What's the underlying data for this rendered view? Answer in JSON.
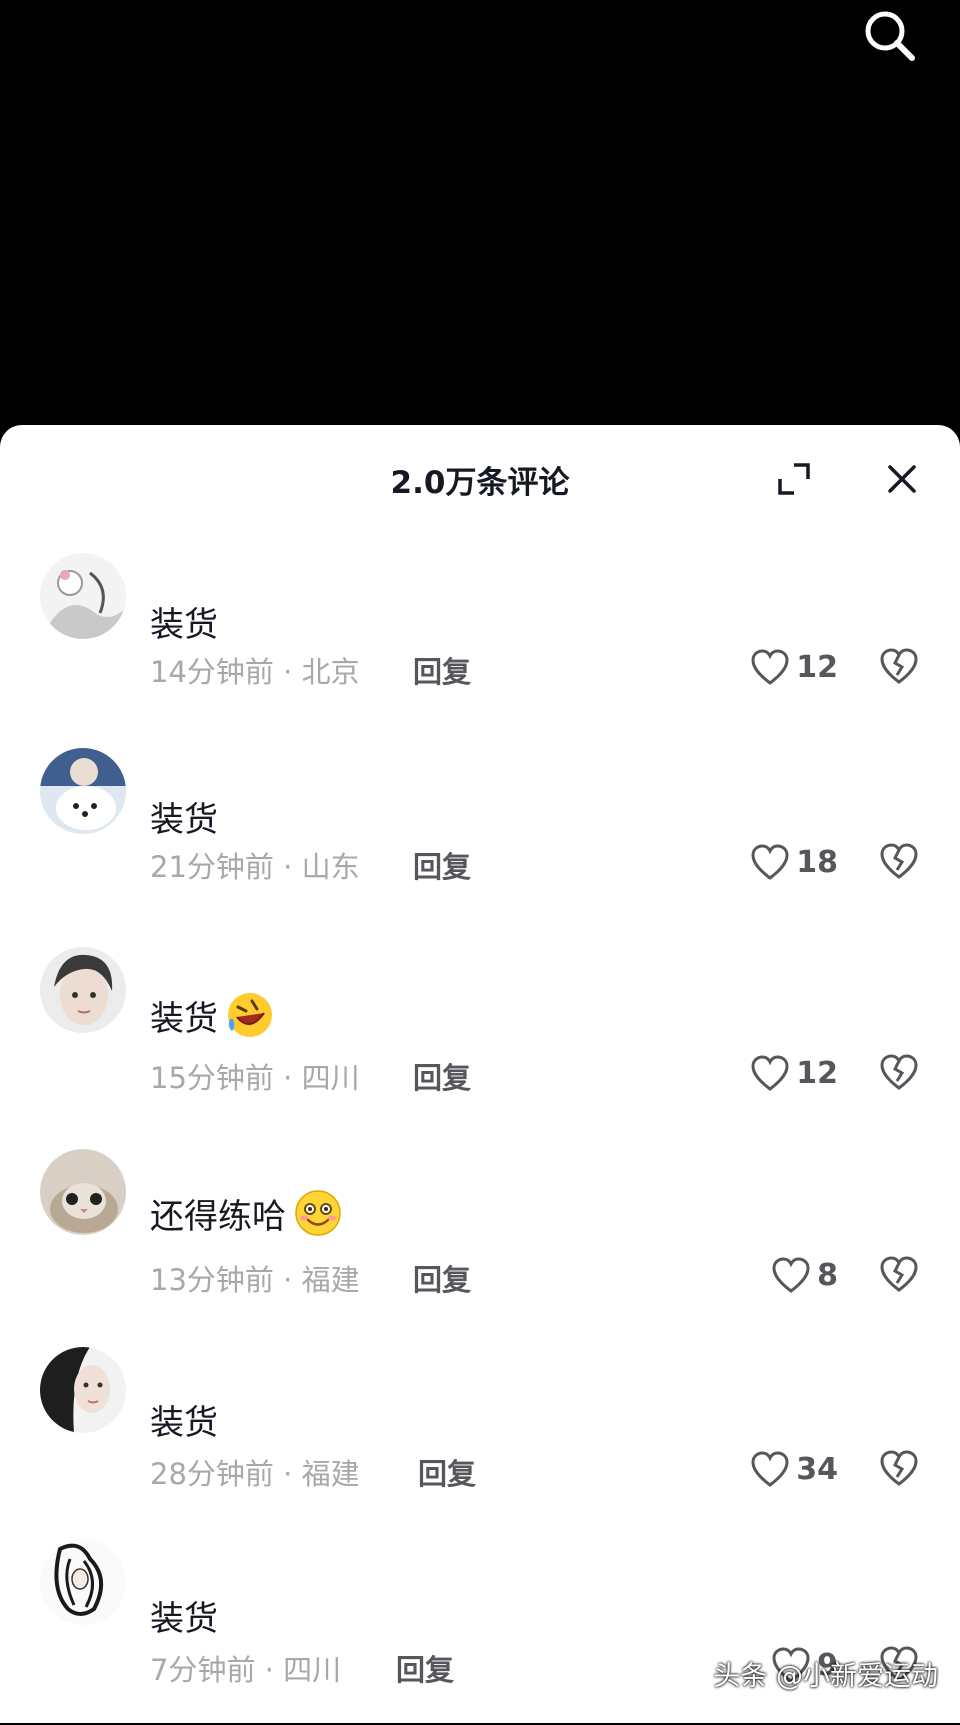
{
  "header": {
    "title": "2.0万条评论"
  },
  "comments": [
    {
      "text": "装货",
      "time": "14分钟前",
      "location": "北京",
      "reply": "回复",
      "likes": "12"
    },
    {
      "text": "装货",
      "time": "21分钟前",
      "location": "山东",
      "reply": "回复",
      "likes": "18"
    },
    {
      "text": "装货",
      "time": "15分钟前",
      "location": "四川",
      "reply": "回复",
      "likes": "12",
      "emoji": "rofl-emoji"
    },
    {
      "text": "还得练哈",
      "time": "13分钟前",
      "location": "福建",
      "reply": "回复",
      "likes": "8",
      "emoji": "smile-emoji"
    },
    {
      "text": "装货",
      "time": "28分钟前",
      "location": "福建",
      "reply": "回复",
      "likes": "34"
    },
    {
      "text": "装货",
      "time": "7分钟前",
      "location": "四川",
      "reply": "回复",
      "likes": "9"
    }
  ],
  "watermark": "头条 @小新爱运动",
  "icons": {
    "search": "search-icon",
    "expand": "expand-icon",
    "close": "close-icon",
    "like": "heart-outline-icon",
    "dislike": "broken-heart-icon"
  }
}
